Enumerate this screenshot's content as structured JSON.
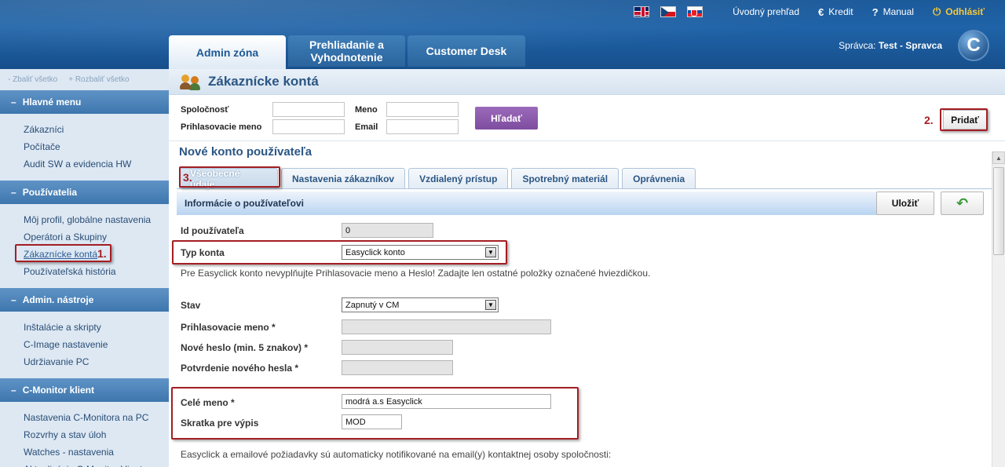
{
  "header": {
    "top_links": [
      {
        "label": "Úvodný prehľad",
        "icon": ""
      },
      {
        "label": "Kredit",
        "icon": "€"
      },
      {
        "label": "Manual",
        "icon": "?"
      },
      {
        "label": "Odhlásiť",
        "icon": "⏻"
      }
    ],
    "tabs": [
      "Admin zóna",
      "Prehliadanie a Vyhodnotenie",
      "Customer Desk"
    ],
    "admin_prefix": "Správca:",
    "admin_name": "Test - Spravca",
    "logo_letter": "C"
  },
  "sidebar": {
    "collapse_all": "- Zbaliť všetko",
    "expand_all": "+ Rozbaliť všetko",
    "sections": [
      {
        "title": "Hlavné menu",
        "items": [
          "Zákazníci",
          "Počítače",
          "Audit SW a evidencia HW"
        ]
      },
      {
        "title": "Používatelia",
        "items": [
          "Môj profil, globálne nastavenia",
          "Operátori a Skupiny",
          "Zákaznícke kontá",
          "Používateľská história"
        ]
      },
      {
        "title": "Admin. nástroje",
        "items": [
          "Inštalácie a skripty",
          "C-Image nastavenie",
          "Udržiavanie PC"
        ]
      },
      {
        "title": "C-Monitor klient",
        "items": [
          "Nastavenia C-Monitora na PC",
          "Rozvrhy a stav úloh",
          "Watches - nastavenia",
          "Aktualizácia C-Monitor klienta"
        ]
      }
    ]
  },
  "main": {
    "title": "Zákaznícke kontá",
    "filter": {
      "company_label": "Spoločnosť",
      "login_label": "Prihlasovacie meno",
      "name_label": "Meno",
      "email_label": "Email",
      "search_button": "Hľadať",
      "add_button": "Pridať"
    },
    "subtitle": "Nové konto používateľa",
    "subtabs": [
      "Všeobecné údaje",
      "Nastavenia zákazníkov",
      "Vzdialený prístup",
      "Spotrebný materiál",
      "Oprávnenia"
    ],
    "section_title": "Informácie o používateľovi",
    "save_button": "Uložiť",
    "form": {
      "id_label": "Id používateľa",
      "id_value": "0",
      "type_label": "Typ konta",
      "type_value": "Easyclick konto",
      "note": "Pre Easyclick konto nevyplňujte Prihlasovacie meno a Heslo! Zadajte len ostatné položky označené hviezdičkou.",
      "status_label": "Stav",
      "status_value": "Zapnutý v CM",
      "login_label": "Prihlasovacie meno *",
      "password_label": "Nové heslo (min. 5 znakov) *",
      "confirm_label": "Potvrdenie nového hesla *",
      "fullname_label": "Celé meno *",
      "fullname_value": "modrá a.s Easyclick",
      "short_label": "Skratka pre výpis",
      "short_value": "MOD",
      "bottom_note": "Easyclick a emailové požiadavky sú automaticky notifikované na email(y) kontaktnej osoby spoločnosti:"
    }
  },
  "annotations": [
    "1.",
    "2.",
    "3."
  ],
  "colors": {
    "accent": "#1f63a8",
    "annotation": "#a41e24",
    "search_button": "#8a58ab"
  }
}
